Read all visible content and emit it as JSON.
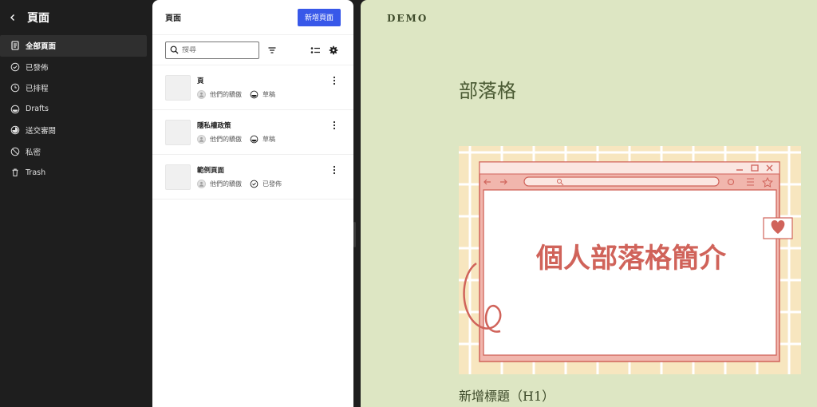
{
  "sidebar": {
    "title": "頁面",
    "items": [
      {
        "label": "全部頁面",
        "icon": "page-icon"
      },
      {
        "label": "已發佈",
        "icon": "check-circle-icon"
      },
      {
        "label": "已排程",
        "icon": "clock-icon"
      },
      {
        "label": "Drafts",
        "icon": "draft-icon"
      },
      {
        "label": "送交審閱",
        "icon": "pending-icon"
      },
      {
        "label": "私密",
        "icon": "private-icon"
      },
      {
        "label": "Trash",
        "icon": "trash-icon"
      }
    ]
  },
  "panel": {
    "title": "頁面",
    "new_button": "新增頁面",
    "search_placeholder": "搜尋",
    "rows": [
      {
        "title": "頁",
        "author": "他們的驕傲",
        "status": "草稿"
      },
      {
        "title": "隱私權政策",
        "author": "他們的驕傲",
        "status": "草稿"
      },
      {
        "title": "範例頁面",
        "author": "他們的驕傲",
        "status": "已發佈"
      }
    ]
  },
  "preview": {
    "site_title": "DEMO",
    "heading": "部落格",
    "hero_text": "個人部落格簡介",
    "caption": "新增標題（H1）"
  },
  "colors": {
    "accent": "#3858e9",
    "sidebar_bg": "#1e1e1e",
    "preview_bg": "#dde6c3",
    "hero_text": "#d0635a"
  }
}
